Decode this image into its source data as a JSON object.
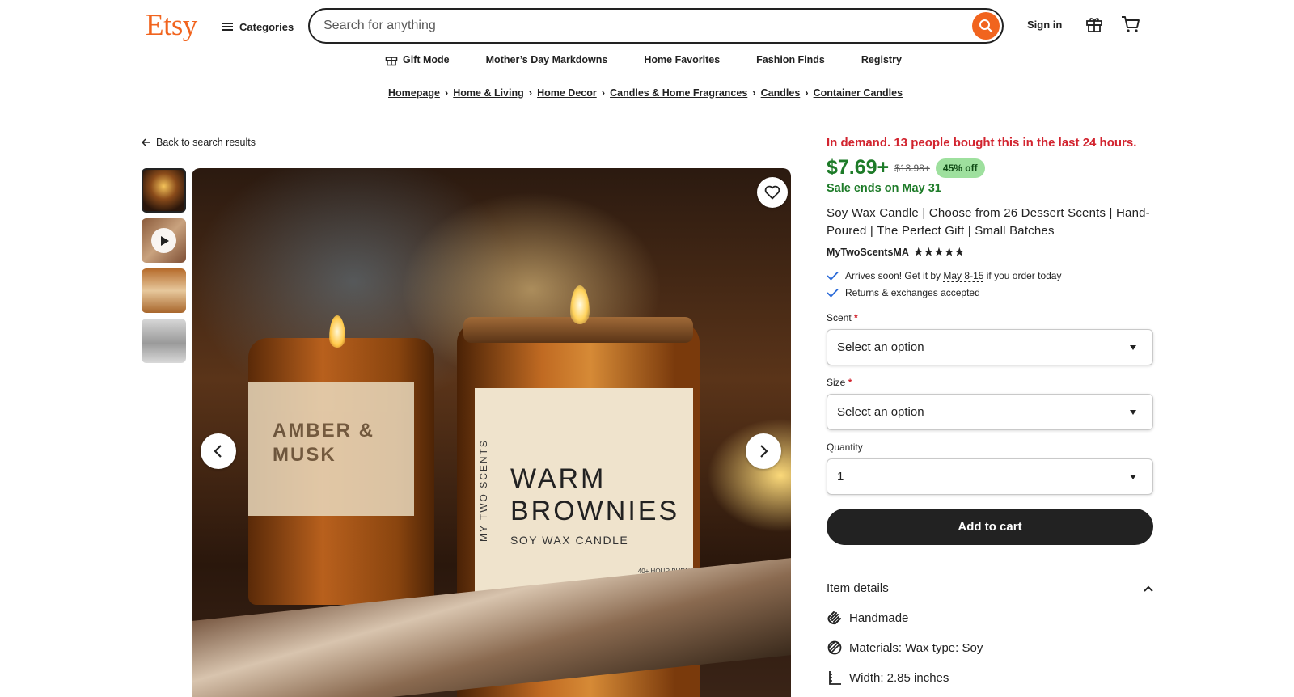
{
  "header": {
    "logo": "Etsy",
    "categories_label": "Categories",
    "search_placeholder": "Search for anything",
    "signin_label": "Sign in"
  },
  "nav": {
    "items": [
      "Gift Mode",
      "Mother’s Day Markdowns",
      "Home Favorites",
      "Fashion Finds",
      "Registry"
    ]
  },
  "breadcrumbs": [
    "Homepage",
    "Home & Living",
    "Home Decor",
    "Candles & Home Fragrances",
    "Candles",
    "Container Candles"
  ],
  "back_label": "Back to search results",
  "photo": {
    "jar1_label": "AMBER &\nMUSK",
    "jar2_brand": "MY TWO SCENTS",
    "jar2_title": "WARM\nBROWNIES",
    "jar2_subtitle": "SOY WAX CANDLE",
    "jar2_burn": "40+ HOUR BURN TIME 7.5 oz | 212 g"
  },
  "product": {
    "demand": "In demand. 13 people bought this in the last 24 hours.",
    "price": "$7.69+",
    "original_price": "$13.98+",
    "discount": "45% off",
    "sale_ends": "Sale ends on May 31",
    "title": "Soy Wax Candle | Choose from 26 Dessert Scents | Hand-Poured | The Perfect Gift | Small Batches",
    "shop": "MyTwoScentsMA",
    "rating_stars": "★★★★★",
    "arrival_prefix": "Arrives soon! Get it by ",
    "arrival_date": "May 8-15",
    "arrival_suffix": " if you order today",
    "returns": "Returns & exchanges accepted",
    "scent_label": "Scent",
    "scent_value": "Select an option",
    "size_label": "Size",
    "size_value": "Select an option",
    "quantity_label": "Quantity",
    "quantity_value": "1",
    "add_to_cart": "Add to cart",
    "item_details": "Item details",
    "details": [
      "Handmade",
      "Materials: Wax type: Soy",
      "Width: 2.85 inches"
    ]
  },
  "colors": {
    "brand": "#f1641e",
    "price_green": "#1d7b28",
    "demand_red": "#d2242f"
  }
}
